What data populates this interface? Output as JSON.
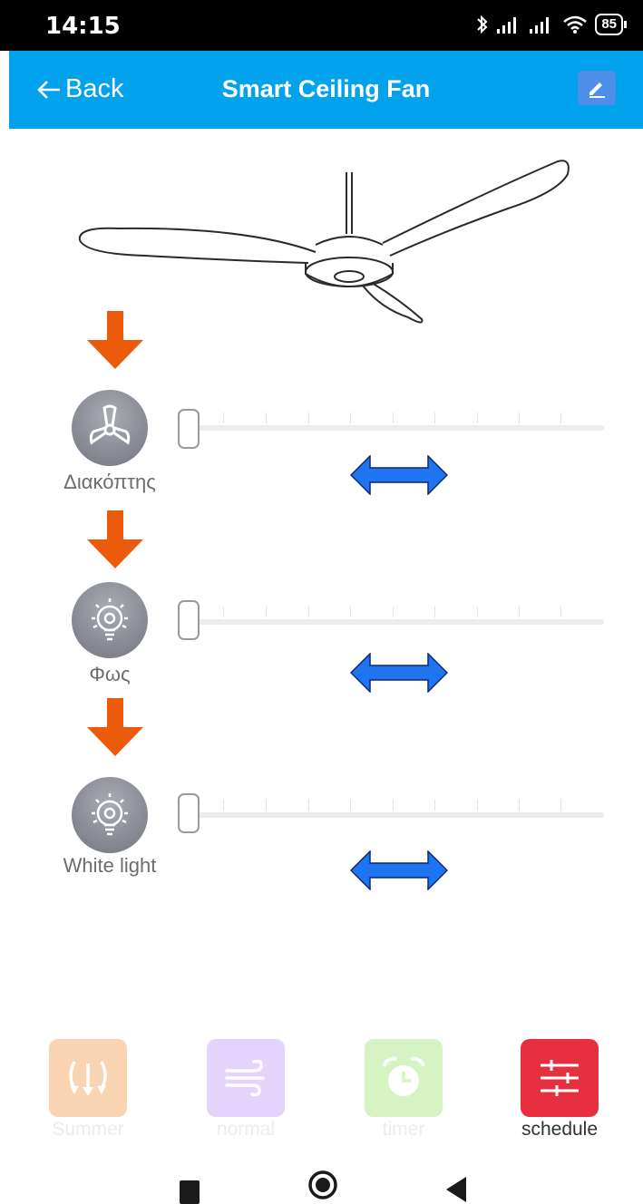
{
  "status_bar": {
    "time": "14:15",
    "battery": "85",
    "icons": [
      "bluetooth-icon",
      "signal-icon",
      "signal-icon",
      "wifi-icon",
      "battery-icon"
    ]
  },
  "app_bar": {
    "back_label": "Back",
    "title": "Smart Ceiling Fan",
    "edit_icon": "pencil-icon",
    "color": "#02a3ec"
  },
  "controls": [
    {
      "label": "Διακόπτης",
      "icon": "fan-icon",
      "level": 0
    },
    {
      "label": "Φως",
      "icon": "bulb-icon",
      "level": 0
    },
    {
      "label": "White light",
      "icon": "bulb-icon",
      "level": 0
    }
  ],
  "modes": [
    {
      "label": "Summer",
      "icon": "summer-arrows-icon",
      "color": "#f9d4b3",
      "active": false
    },
    {
      "label": "normal",
      "icon": "wind-icon",
      "color": "#e4d4fb",
      "active": false
    },
    {
      "label": "timer",
      "icon": "alarm-clock-icon",
      "color": "#d6f3c4",
      "active": false
    },
    {
      "label": "schedule",
      "icon": "sliders-icon",
      "color": "#e6303f",
      "active": true
    }
  ],
  "colors": {
    "annotation_arrow_orange": "#ec5a0b",
    "annotation_arrow_blue": "#1f74ef"
  }
}
